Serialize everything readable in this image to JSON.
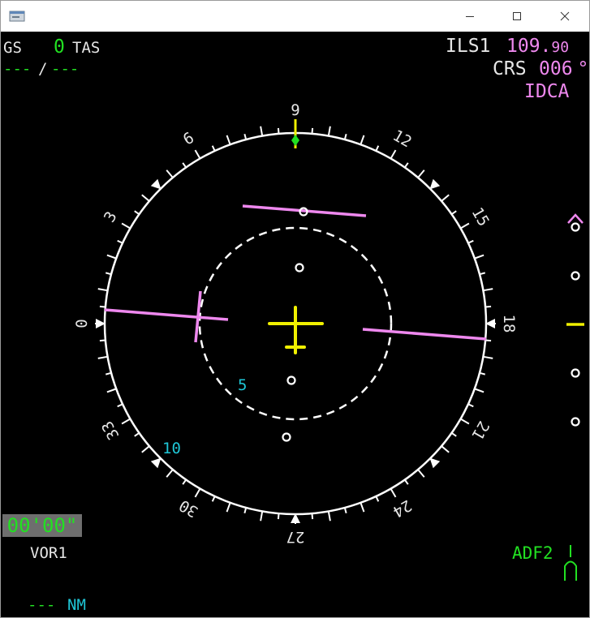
{
  "window": {
    "app_icon": "app-window-icon",
    "controls": {
      "minimize_icon": "minimize-icon",
      "maximize_icon": "maximize-icon",
      "close_icon": "close-icon"
    }
  },
  "top_left": {
    "gs_label": "GS",
    "gs_value": "0",
    "tas_label": "TAS",
    "wind_dir": "---",
    "wind_sep": "/",
    "wind_speed": "---"
  },
  "top_right": {
    "nav_source": "ILS1",
    "freq_main": "109.",
    "freq_decimal": "90",
    "crs_label": "CRS",
    "crs_value": "006",
    "crs_unit": "°",
    "ident": "IDCA"
  },
  "compass": {
    "labels": [
      "0",
      "3",
      "6",
      "9",
      "12",
      "15",
      "18",
      "21",
      "24",
      "27",
      "30",
      "33"
    ],
    "range_inner": "5",
    "range_outer": "10"
  },
  "bottom_left": {
    "chrono": "00'00\"",
    "nav_source": "VOR1",
    "distance_value": "---",
    "distance_unit": "NM"
  },
  "bottom_right": {
    "adf_label": "ADF2",
    "adf_pointer_icon": "adf-needle-icon"
  },
  "glideslope": {
    "top_icon": "glideslope-caret-icon",
    "index_icon": "glideslope-index-icon"
  },
  "aircraft_symbol": "aircraft-symbol-icon",
  "colors": {
    "background": "#000000",
    "white": "#e6e6e6",
    "green": "#22e022",
    "magenta": "#ee88ee",
    "cyan": "#1fc6d6",
    "yellow": "#f0f000",
    "chrono_bg": "#6e6e6e"
  }
}
